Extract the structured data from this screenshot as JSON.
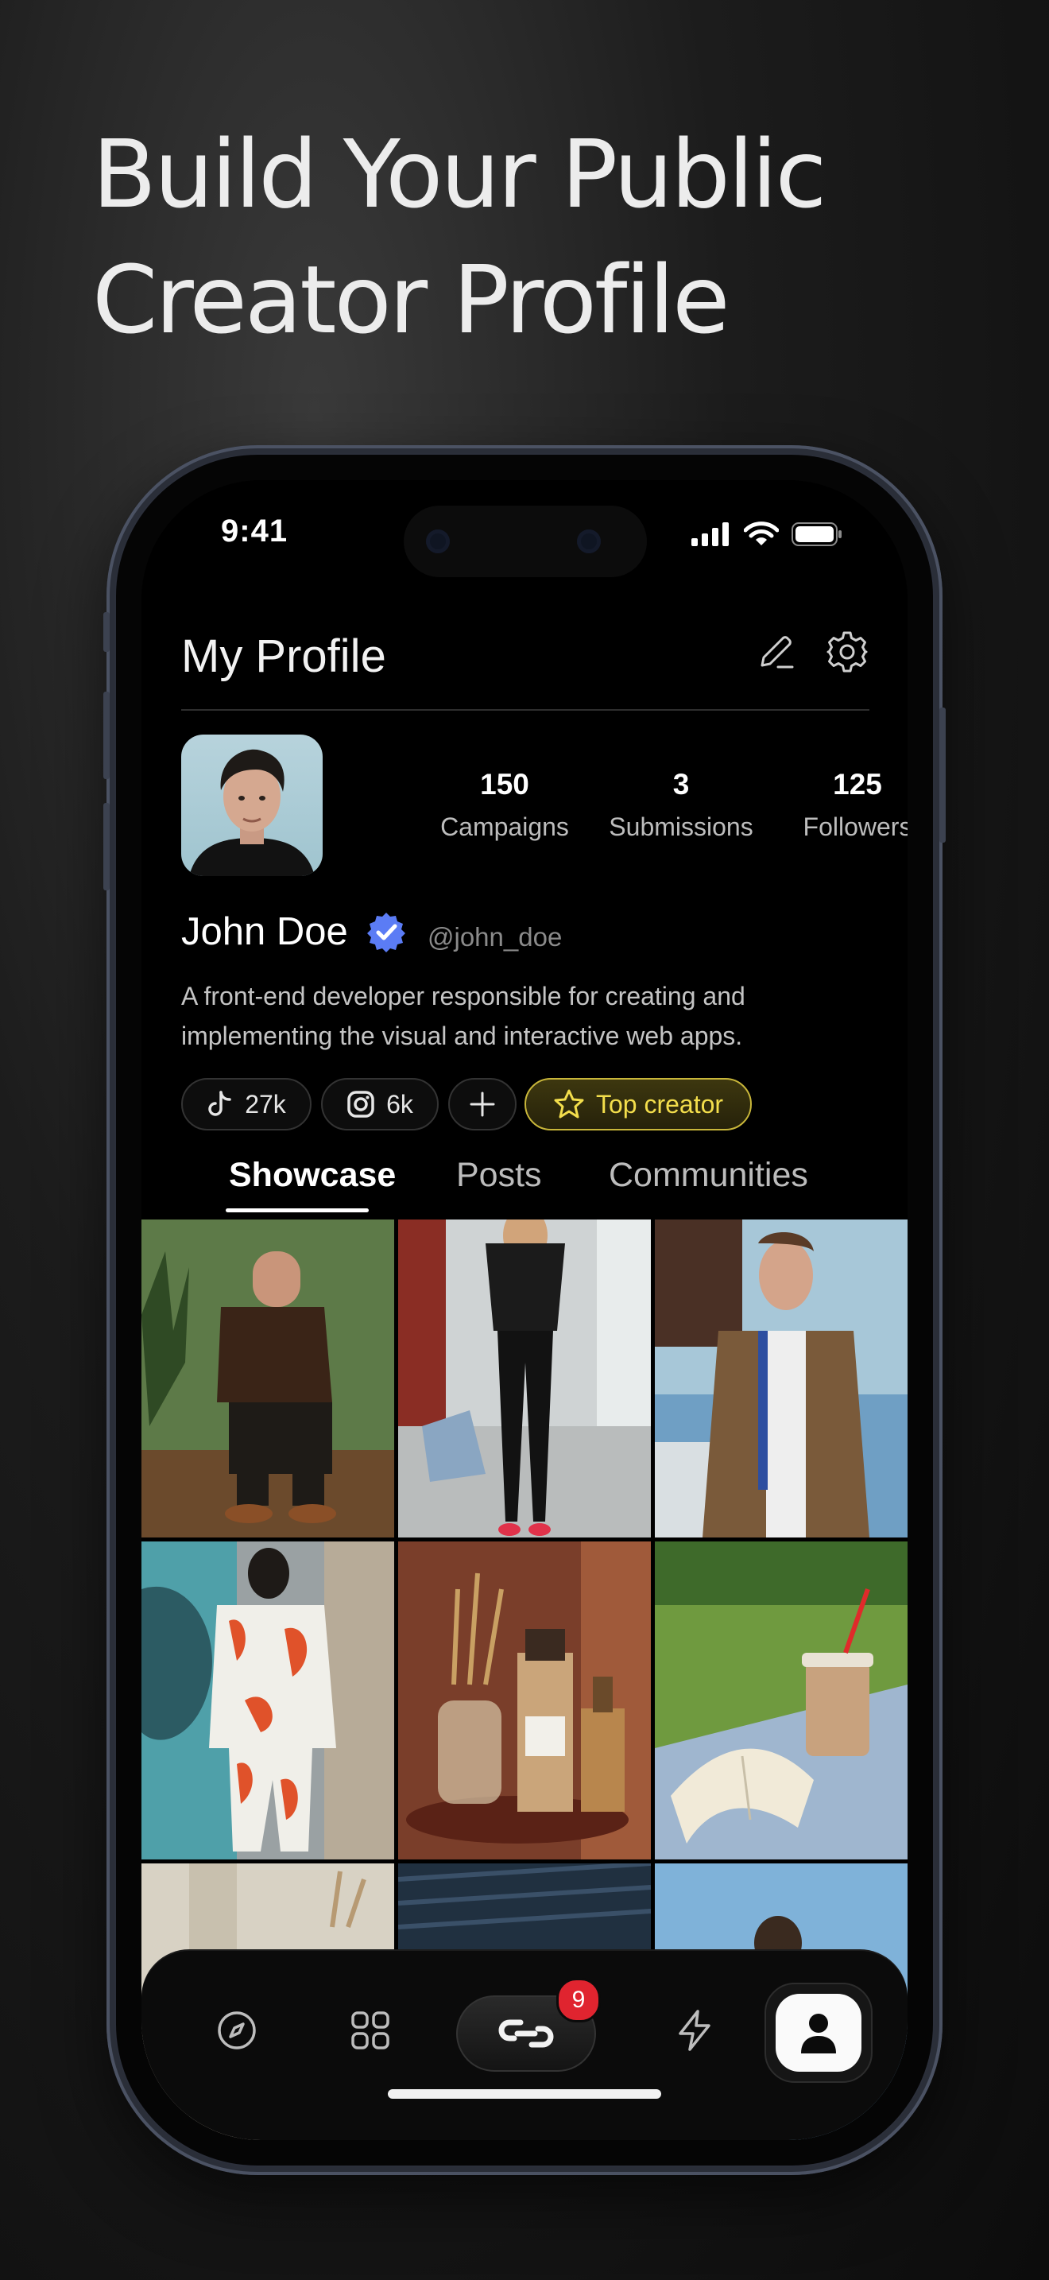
{
  "headline": [
    "Build Your Public",
    "Creator Profile"
  ],
  "status": {
    "time": "9:41"
  },
  "header": {
    "title": "My Profile",
    "edit_icon": "pencil-icon",
    "settings_icon": "gear-icon"
  },
  "stats": [
    {
      "value": "150",
      "label": "Campaigns"
    },
    {
      "value": "3",
      "label": "Submissions"
    },
    {
      "value": "125",
      "label": "Followers"
    }
  ],
  "profile": {
    "name": "John Doe",
    "handle": "@john_doe",
    "bio": "A front-end developer responsible for creating and implementing the visual and interactive web apps.",
    "verified_color": "#5b7cf5"
  },
  "chips": [
    {
      "icon": "tiktok-icon",
      "label": "27k"
    },
    {
      "icon": "instagram-icon",
      "label": "6k"
    },
    {
      "icon": "plus-icon",
      "label": ""
    },
    {
      "icon": "star-icon",
      "label": "Top creator"
    }
  ],
  "tabs": [
    {
      "label": "Showcase",
      "active": true
    },
    {
      "label": "Posts",
      "active": false
    },
    {
      "label": "Communities",
      "active": false
    }
  ],
  "nav": {
    "items": [
      "compass-icon",
      "grid-icon",
      "link-icon",
      "bolt-icon",
      "profile-icon"
    ],
    "badge": "9"
  },
  "colors": {
    "accent_gold": "#f3de4c",
    "badge_red": "#e0242f",
    "verified_blue": "#5b7cf5"
  }
}
